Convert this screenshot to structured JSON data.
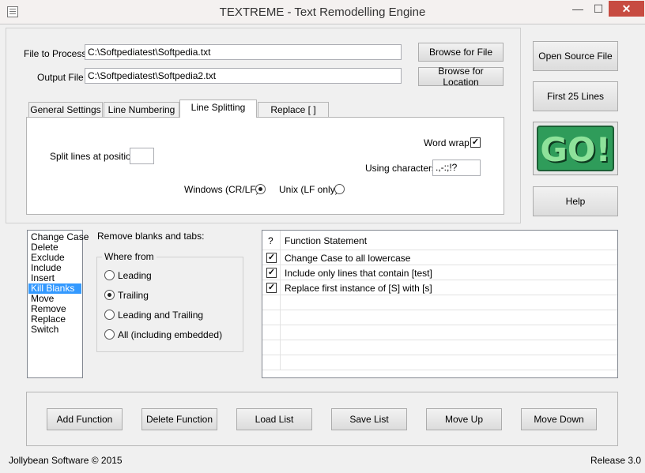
{
  "window": {
    "title": "TEXTREME - Text Remodelling Engine",
    "min_glyph": "—",
    "max_glyph": "☐",
    "close_glyph": "✕"
  },
  "files": {
    "process_label": "File to Process",
    "process_value": "C:\\Softpediatest\\Softpedia.txt",
    "output_label": "Output File",
    "output_value": "C:\\Softpediatest\\Softpedia2.txt",
    "browse_file": "Browse for File",
    "browse_location": "Browse for Location"
  },
  "right_buttons": {
    "open_source": "Open Source File",
    "first_lines": "First 25 Lines",
    "go": "GO!",
    "help": "Help"
  },
  "tabs": [
    "General Settings",
    "Line Numbering",
    "Line Splitting",
    "Replace [ ]"
  ],
  "splitting": {
    "split_label": "Split lines at position",
    "split_value": "",
    "word_wrap_label": "Word wrap",
    "word_wrap_checked": true,
    "using_chars_label": "Using characters",
    "using_chars_value": ".,-:;!?",
    "windows_label": "Windows (CR/LF)",
    "unix_label": "Unix (LF only)",
    "selected": "windows"
  },
  "functions_list": {
    "items": [
      "Change Case",
      "Delete",
      "Exclude",
      "Include",
      "Insert",
      "Kill Blanks",
      "Move",
      "Remove",
      "Replace",
      "Switch"
    ],
    "selected": "Kill Blanks"
  },
  "kill_blanks": {
    "heading": "Remove blanks and tabs:",
    "group_label": "Where from",
    "options": [
      "Leading",
      "Trailing",
      "Leading and Trailing",
      "All (including embedded)"
    ],
    "selected": "Trailing"
  },
  "statement_table": {
    "col_check": "?",
    "col_statement": "Function Statement",
    "rows": [
      {
        "checked": true,
        "text": "Change Case to all lowercase"
      },
      {
        "checked": true,
        "text": "Include only lines that contain [test]"
      },
      {
        "checked": true,
        "text": "Replace first instance of [S] with [s]"
      }
    ]
  },
  "bottom_buttons": {
    "add": "Add Function",
    "delete": "Delete Function",
    "load": "Load List",
    "save": "Save List",
    "up": "Move Up",
    "down": "Move Down"
  },
  "status": {
    "copyright": "Jollybean Software © 2015",
    "release": "Release 3.0"
  },
  "colors": {
    "go_background": "#2f9c5a",
    "go_text": "#8ee29a",
    "selection": "#3399ff",
    "close_button": "#c74b41"
  }
}
